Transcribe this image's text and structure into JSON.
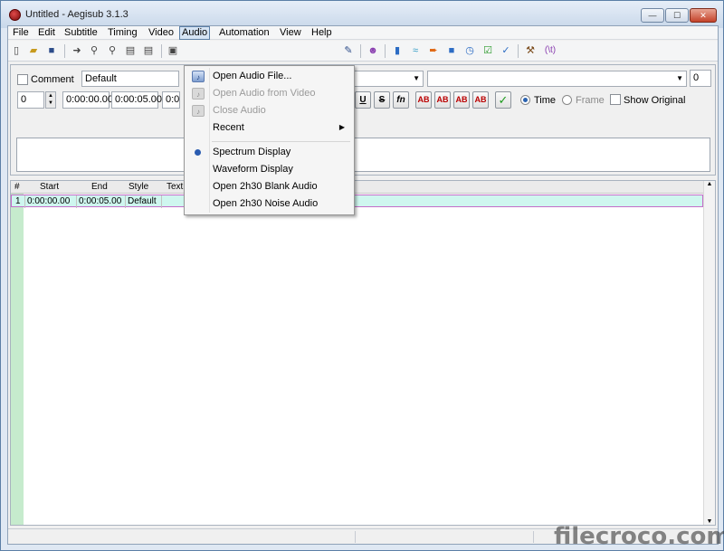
{
  "window": {
    "title": "Untitled - Aegisub 3.1.3",
    "controls": {
      "minimize": "—",
      "maximize": "☐",
      "close": "✕"
    }
  },
  "menubar": {
    "items": [
      {
        "label": "File"
      },
      {
        "label": "Edit"
      },
      {
        "label": "Subtitle"
      },
      {
        "label": "Timing"
      },
      {
        "label": "Video"
      },
      {
        "label": "Audio",
        "active": true
      },
      {
        "label": "Automation"
      },
      {
        "label": "View"
      },
      {
        "label": "Help"
      }
    ]
  },
  "toolbar": {
    "icons": [
      "new-file-icon",
      "open-file-icon",
      "save-icon",
      "arrow-icon",
      "pipette-icon",
      "pipette-icon",
      "clip-icon",
      "clip-icon",
      "properties-icon",
      "script-icon",
      "audio-icon",
      "purple-face-icon",
      "jump-icon",
      "timing-icon",
      "shift-icon",
      "stop-icon",
      "clock-icon",
      "check-icon",
      "validate-icon",
      "hammer-icon",
      "text-tag-icon"
    ],
    "text_tag": "(\\t)"
  },
  "edit_panel": {
    "comment_label": "Comment",
    "style_value": "Default",
    "layer_value": "0",
    "start_time": "0:00:00.00",
    "end_time": "0:00:05.00",
    "duration_partial": "0:0",
    "margin_value": "0",
    "format_buttons": {
      "underline": "U",
      "strike": "S",
      "font": "fn",
      "color1": "AB",
      "color2": "AB",
      "color3": "AB",
      "color4": "AB",
      "commit": "✓"
    },
    "time_label": "Time",
    "frame_label": "Frame",
    "show_original_label": "Show Original"
  },
  "grid": {
    "headers": [
      "#",
      "Start",
      "End",
      "Style",
      "Text"
    ],
    "rows": [
      {
        "num": "1",
        "start": "0:00:00.00",
        "end": "0:00:05.00",
        "style": "Default",
        "text": ""
      }
    ]
  },
  "audio_menu": {
    "items": [
      {
        "label": "Open Audio File...",
        "icon": "audio-file-icon",
        "disabled": false
      },
      {
        "label": "Open Audio from Video",
        "icon": "audio-video-icon",
        "disabled": true
      },
      {
        "label": "Close Audio",
        "icon": "close-audio-icon",
        "disabled": true
      },
      {
        "label": "Recent",
        "submenu": true,
        "disabled": false
      },
      {
        "label": "Spectrum Display",
        "checked": true,
        "disabled": false
      },
      {
        "label": "Waveform Display",
        "disabled": false
      },
      {
        "label": "Open 2h30 Blank Audio",
        "disabled": false
      },
      {
        "label": "Open 2h30 Noise Audio",
        "disabled": false
      }
    ]
  },
  "watermark": "filecroco.com",
  "colors": {
    "selected_row": "#cff6ef",
    "row_gutter": "#c6ebcd",
    "row_border": "#c46ec9",
    "accent": "#2a5cb0"
  }
}
